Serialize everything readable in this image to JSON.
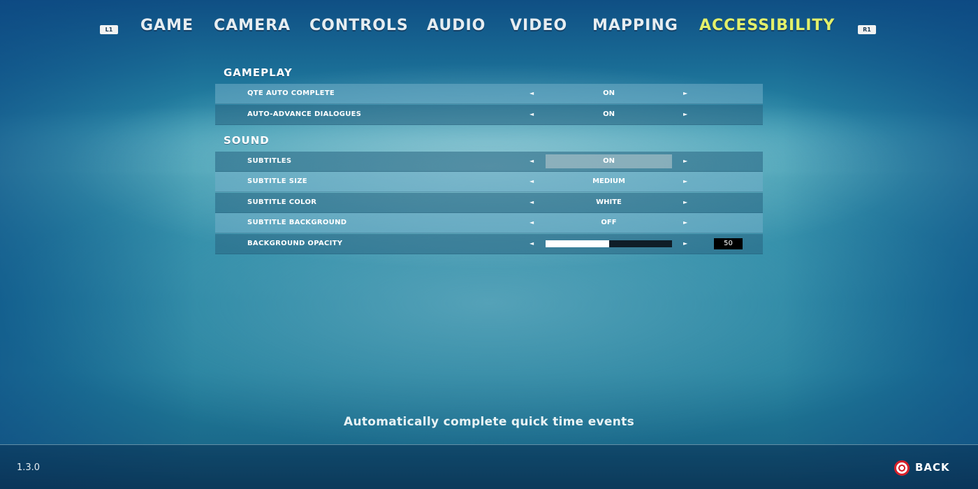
{
  "tabs": {
    "left_bumper": "L1",
    "right_bumper": "R1",
    "items": [
      {
        "label": "GAME",
        "active": false
      },
      {
        "label": "CAMERA",
        "active": false
      },
      {
        "label": "CONTROLS",
        "active": false
      },
      {
        "label": "AUDIO",
        "active": false
      },
      {
        "label": "VIDEO",
        "active": false
      },
      {
        "label": "MAPPING",
        "active": false
      },
      {
        "label": "ACCESSIBILITY",
        "active": true
      }
    ],
    "active_color": "#e3f06a"
  },
  "sections": [
    {
      "title": "GAMEPLAY",
      "rows": [
        {
          "label": "QTE AUTO COMPLETE",
          "value": "ON"
        },
        {
          "label": "AUTO-ADVANCE DIALOGUES",
          "value": "ON"
        }
      ]
    },
    {
      "title": "SOUND",
      "rows": [
        {
          "label": "SUBTITLES",
          "value": "ON",
          "selected": true
        },
        {
          "label": "SUBTITLE SIZE",
          "value": "MEDIUM"
        },
        {
          "label": "SUBTITLE COLOR",
          "value": "WHITE"
        },
        {
          "label": "SUBTITLE BACKGROUND",
          "value": "OFF"
        },
        {
          "label": "BACKGROUND OPACITY",
          "slider_value": "50",
          "slider_fraction": 0.5
        }
      ]
    }
  ],
  "arrows": {
    "left": "◄",
    "right": "►"
  },
  "description": "Automatically complete quick time events",
  "footer": {
    "version": "1.3.0",
    "back_label": "BACK",
    "back_icon": "circle-button-icon",
    "back_icon_color": "#d8202a"
  }
}
